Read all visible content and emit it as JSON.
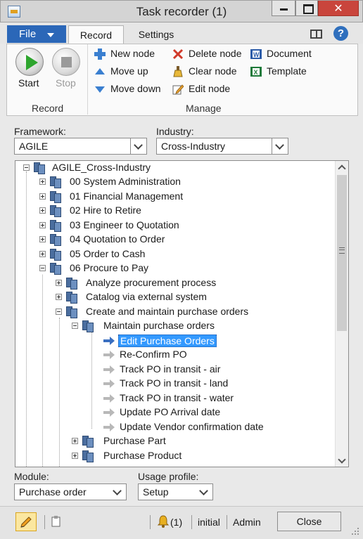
{
  "window": {
    "title": "Task recorder (1)",
    "close_glyph": "✕"
  },
  "ribbon_tabs": {
    "file": "File",
    "record": "Record",
    "settings": "Settings",
    "help_glyph": "?"
  },
  "ribbon": {
    "record_group": {
      "label": "Record",
      "start": "Start",
      "stop": "Stop"
    },
    "manage_group": {
      "label": "Manage",
      "new_node": "New node",
      "move_up": "Move up",
      "move_down": "Move down",
      "delete_node": "Delete node",
      "clear_node": "Clear node",
      "edit_node": "Edit node",
      "document": "Document",
      "template": "Template"
    }
  },
  "filters": {
    "framework_label": "Framework:",
    "framework_value": "AGILE",
    "industry_label": "Industry:",
    "industry_value": "Cross-Industry"
  },
  "tree": {
    "root": "AGILE_Cross-Industry",
    "level1": [
      "00 System Administration",
      "01 Financial Management",
      "02 Hire to Retire",
      "03 Engineer to Quotation",
      "04 Quotation to Order",
      "05 Order to Cash",
      "06 Procure to Pay"
    ],
    "level2": [
      "Analyze procurement process",
      "Catalog via external system",
      "Create and maintain purchase orders"
    ],
    "level3": "Maintain purchase orders",
    "tasks": [
      "Edit Purchase Orders",
      "Re-Confirm PO",
      "Track PO in transit - air",
      "Track PO in transit - land",
      "Track PO in transit - water",
      "Update PO Arrival date",
      "Update Vendor confirmation date"
    ],
    "selected_task": "Edit Purchase Orders",
    "after": [
      "Purchase Part",
      "Purchase Product"
    ]
  },
  "bottom_filters": {
    "module_label": "Module:",
    "module_value": "Purchase order",
    "usage_label": "Usage profile:",
    "usage_value": "Setup"
  },
  "status": {
    "notifications": "(1)",
    "company": "initial",
    "user": "Admin",
    "close": "Close"
  },
  "colors": {
    "accent": "#2b67b8",
    "selection": "#3399ff",
    "close_red": "#c9453c"
  }
}
